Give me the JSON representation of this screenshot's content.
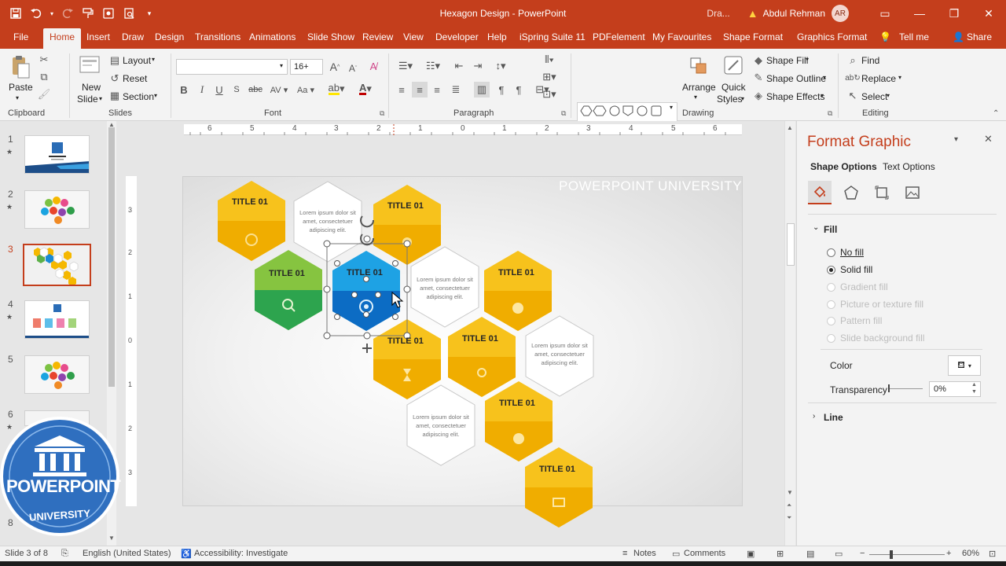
{
  "window": {
    "title": "Hexagon Design  -  PowerPoint",
    "draft_label": "Dra...",
    "user_name": "Abdul Rehman",
    "user_initials": "AR"
  },
  "tabs": [
    "File",
    "Home",
    "Insert",
    "Draw",
    "Design",
    "Transitions",
    "Animations",
    "Slide Show",
    "Review",
    "View",
    "Developer",
    "Help",
    "iSpring Suite 11",
    "PDFelement",
    "My Favourites",
    "Shape Format",
    "Graphics Format"
  ],
  "tell_me": "Tell me",
  "share": "Share",
  "ribbon": {
    "clipboard": {
      "label": "Clipboard",
      "paste": "Paste"
    },
    "slides": {
      "label": "Slides",
      "new_slide_1": "New",
      "new_slide_2": "Slide",
      "layout": "Layout",
      "reset": "Reset",
      "section": "Section"
    },
    "font": {
      "label": "Font",
      "font_name": "",
      "font_size": "16+"
    },
    "paragraph": {
      "label": "Paragraph"
    },
    "drawing": {
      "label": "Drawing",
      "arrange": "Arrange",
      "quick_styles_1": "Quick",
      "quick_styles_2": "Styles",
      "shape_fill": "Shape Fill",
      "shape_outline": "Shape Outline",
      "shape_effects": "Shape Effects"
    },
    "editing": {
      "label": "Editing",
      "find": "Find",
      "replace": "Replace",
      "select": "Select"
    }
  },
  "slides": [
    {
      "num": "1",
      "star": true
    },
    {
      "num": "2",
      "star": true
    },
    {
      "num": "3",
      "star": false,
      "selected": true
    },
    {
      "num": "4",
      "star": true
    },
    {
      "num": "5",
      "star": false
    },
    {
      "num": "6",
      "star": true
    },
    {
      "num": "8",
      "star": false
    }
  ],
  "slide": {
    "watermark": "POWERPOINT UNIVERSITY",
    "hex_title": "TITLE 01",
    "lorem_1": "Lorem ipsum dolor sit",
    "lorem_2": "amet, consectetuer",
    "lorem_3": "adipiscing elit.",
    "selected_title": "TITLE 01"
  },
  "ruler": {
    "h_ticks": [
      "6",
      "5",
      "4",
      "3",
      "2",
      "1",
      "0",
      "1",
      "2",
      "3",
      "4",
      "5",
      "6"
    ],
    "v_ticks": [
      "3",
      "2",
      "1",
      "0",
      "1",
      "2",
      "3"
    ]
  },
  "format_pane": {
    "title": "Format Graphic",
    "tab_shape": "Shape Options",
    "tab_text": "Text Options",
    "fill_section": "Fill",
    "options": [
      "No fill",
      "Solid fill",
      "Gradient fill",
      "Picture or texture fill",
      "Pattern fill",
      "Slide background fill"
    ],
    "color_label": "Color",
    "transparency_label": "Transparency",
    "transparency_value": "0%",
    "line_section": "Line"
  },
  "status": {
    "slide_info": "Slide 3 of 8",
    "language": "English (United States)",
    "accessibility": "Accessibility: Investigate",
    "notes": "Notes",
    "comments": "Comments",
    "zoom": "60%"
  },
  "logo": {
    "text_main": "POWERPOINT",
    "text_sub": "UNIVERSITY"
  },
  "colors": {
    "accent": "#c43e1c",
    "yellow_hex": "#f5b800",
    "yellow_dark": "#e09a00",
    "green_light": "#7cc242",
    "green_dark": "#2f9e4a",
    "blue_light": "#1aa3e0",
    "blue_dark": "#0b6fc2"
  }
}
